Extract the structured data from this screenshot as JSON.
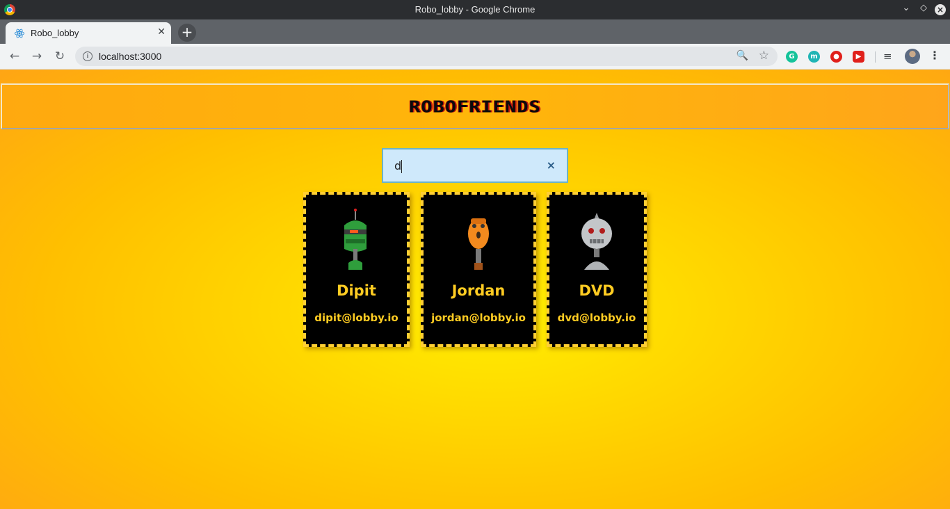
{
  "window": {
    "title": "Robo_lobby - Google Chrome"
  },
  "tab": {
    "title": "Robo_lobby",
    "icon": "react-icon"
  },
  "toolbar": {
    "url": "localhost:3000"
  },
  "extensions": [
    {
      "name": "grammarly-icon",
      "glyph": "G",
      "color": "#15c39a"
    },
    {
      "name": "extension-m-icon",
      "glyph": "m",
      "color": "#1fb5b5"
    },
    {
      "name": "extension-red-icon",
      "glyph": "●",
      "color": "#e0201b"
    },
    {
      "name": "extension-play-icon",
      "glyph": "▶",
      "color": "#e0201b"
    }
  ],
  "page": {
    "header": {
      "title": "ROBOFRIENDS"
    },
    "search": {
      "value": "d",
      "clear": "×"
    },
    "robots": [
      {
        "name": "Dipit",
        "email": "dipit@lobby.io",
        "color": "#3cb54a"
      },
      {
        "name": "Jordan",
        "email": "jordan@lobby.io",
        "color": "#f28a1e"
      },
      {
        "name": "DVD",
        "email": "dvd@lobby.io",
        "color": "#b9bcbf"
      }
    ]
  },
  "colors": {
    "accent": "#ffcc22",
    "background": "#ffd800",
    "card": "#000000"
  }
}
